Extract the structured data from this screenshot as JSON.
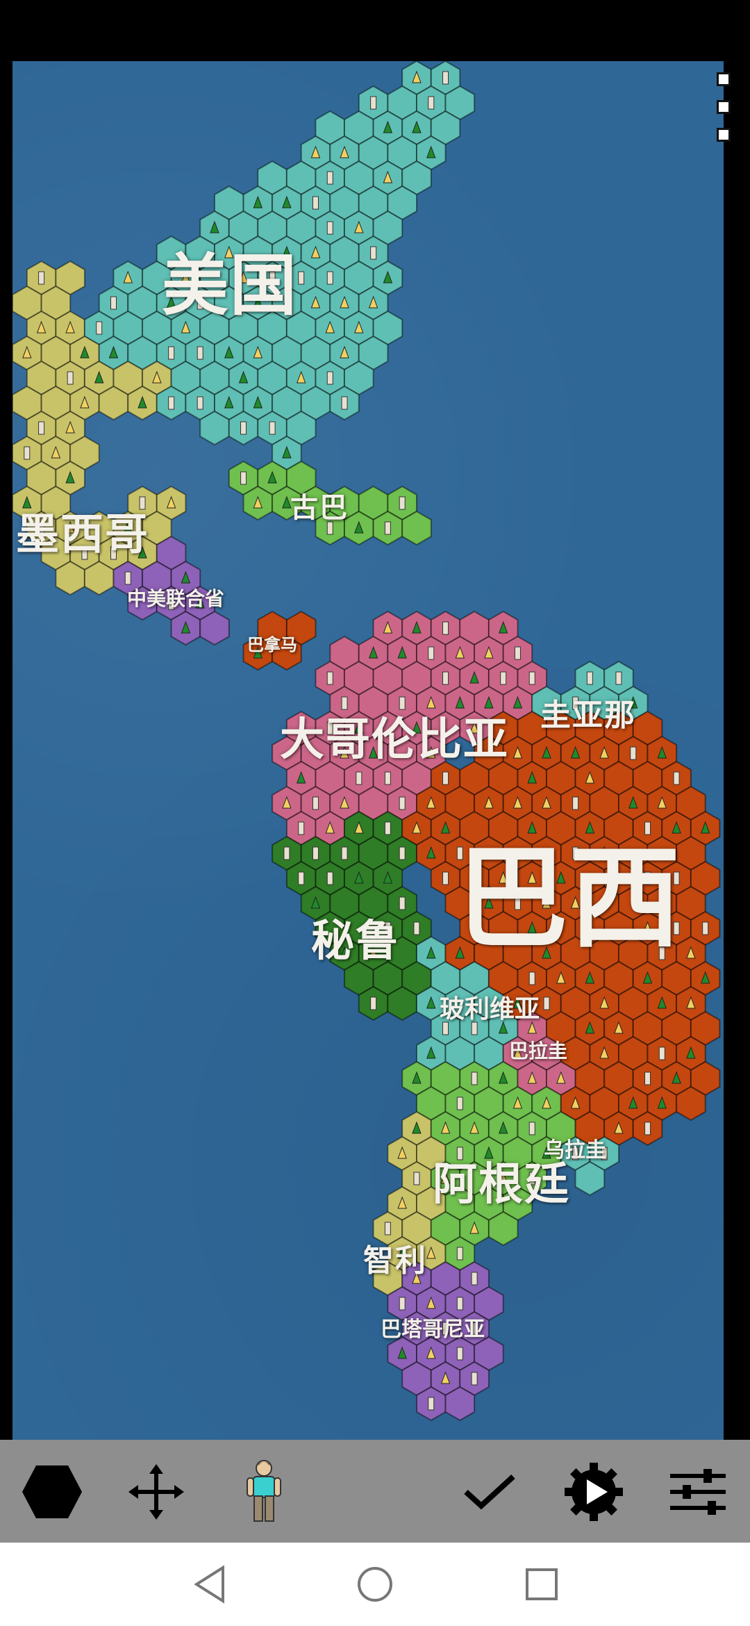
{
  "labels": {
    "usa": "美国",
    "mexico": "墨西哥",
    "cuba": "古巴",
    "central_america": "中美联合省",
    "panama": "巴拿马",
    "colombia": "大哥伦比亚",
    "guiana": "圭亚那",
    "brazil": "巴西",
    "peru": "秘鲁",
    "bolivia": "玻利维亚",
    "paraguay": "巴拉圭",
    "uruguay": "乌拉圭",
    "argentina": "阿根廷",
    "chile": "智利",
    "patagonia": "巴塔哥尼亚"
  },
  "colors": {
    "ocean": "#2f6797",
    "usa": "#5fbfb4",
    "mexico": "#c8c368",
    "central_america": "#8e62b8",
    "panama": "#c4470f",
    "cuba": "#6fc04e",
    "colombia": "#cc6688",
    "brazil": "#c4470f",
    "peru": "#2f7d26",
    "bolivia": "#5fbfb4",
    "paraguay": "#cc6688",
    "argentina": "#6fc04e",
    "chile": "#c8c368",
    "patagonia": "#8e62b8",
    "toolbar": "#8e8e8e"
  },
  "toolbar": {
    "hex_tool": "hexagon-icon",
    "move_tool": "move-arrows-icon",
    "unit_tool": "person-icon",
    "confirm_tool": "check-icon",
    "play_tool": "gear-play-icon",
    "settings_tool": "sliders-icon"
  },
  "navbar": {
    "back": "back-triangle-icon",
    "home": "home-circle-icon",
    "recents": "recents-square-icon"
  }
}
